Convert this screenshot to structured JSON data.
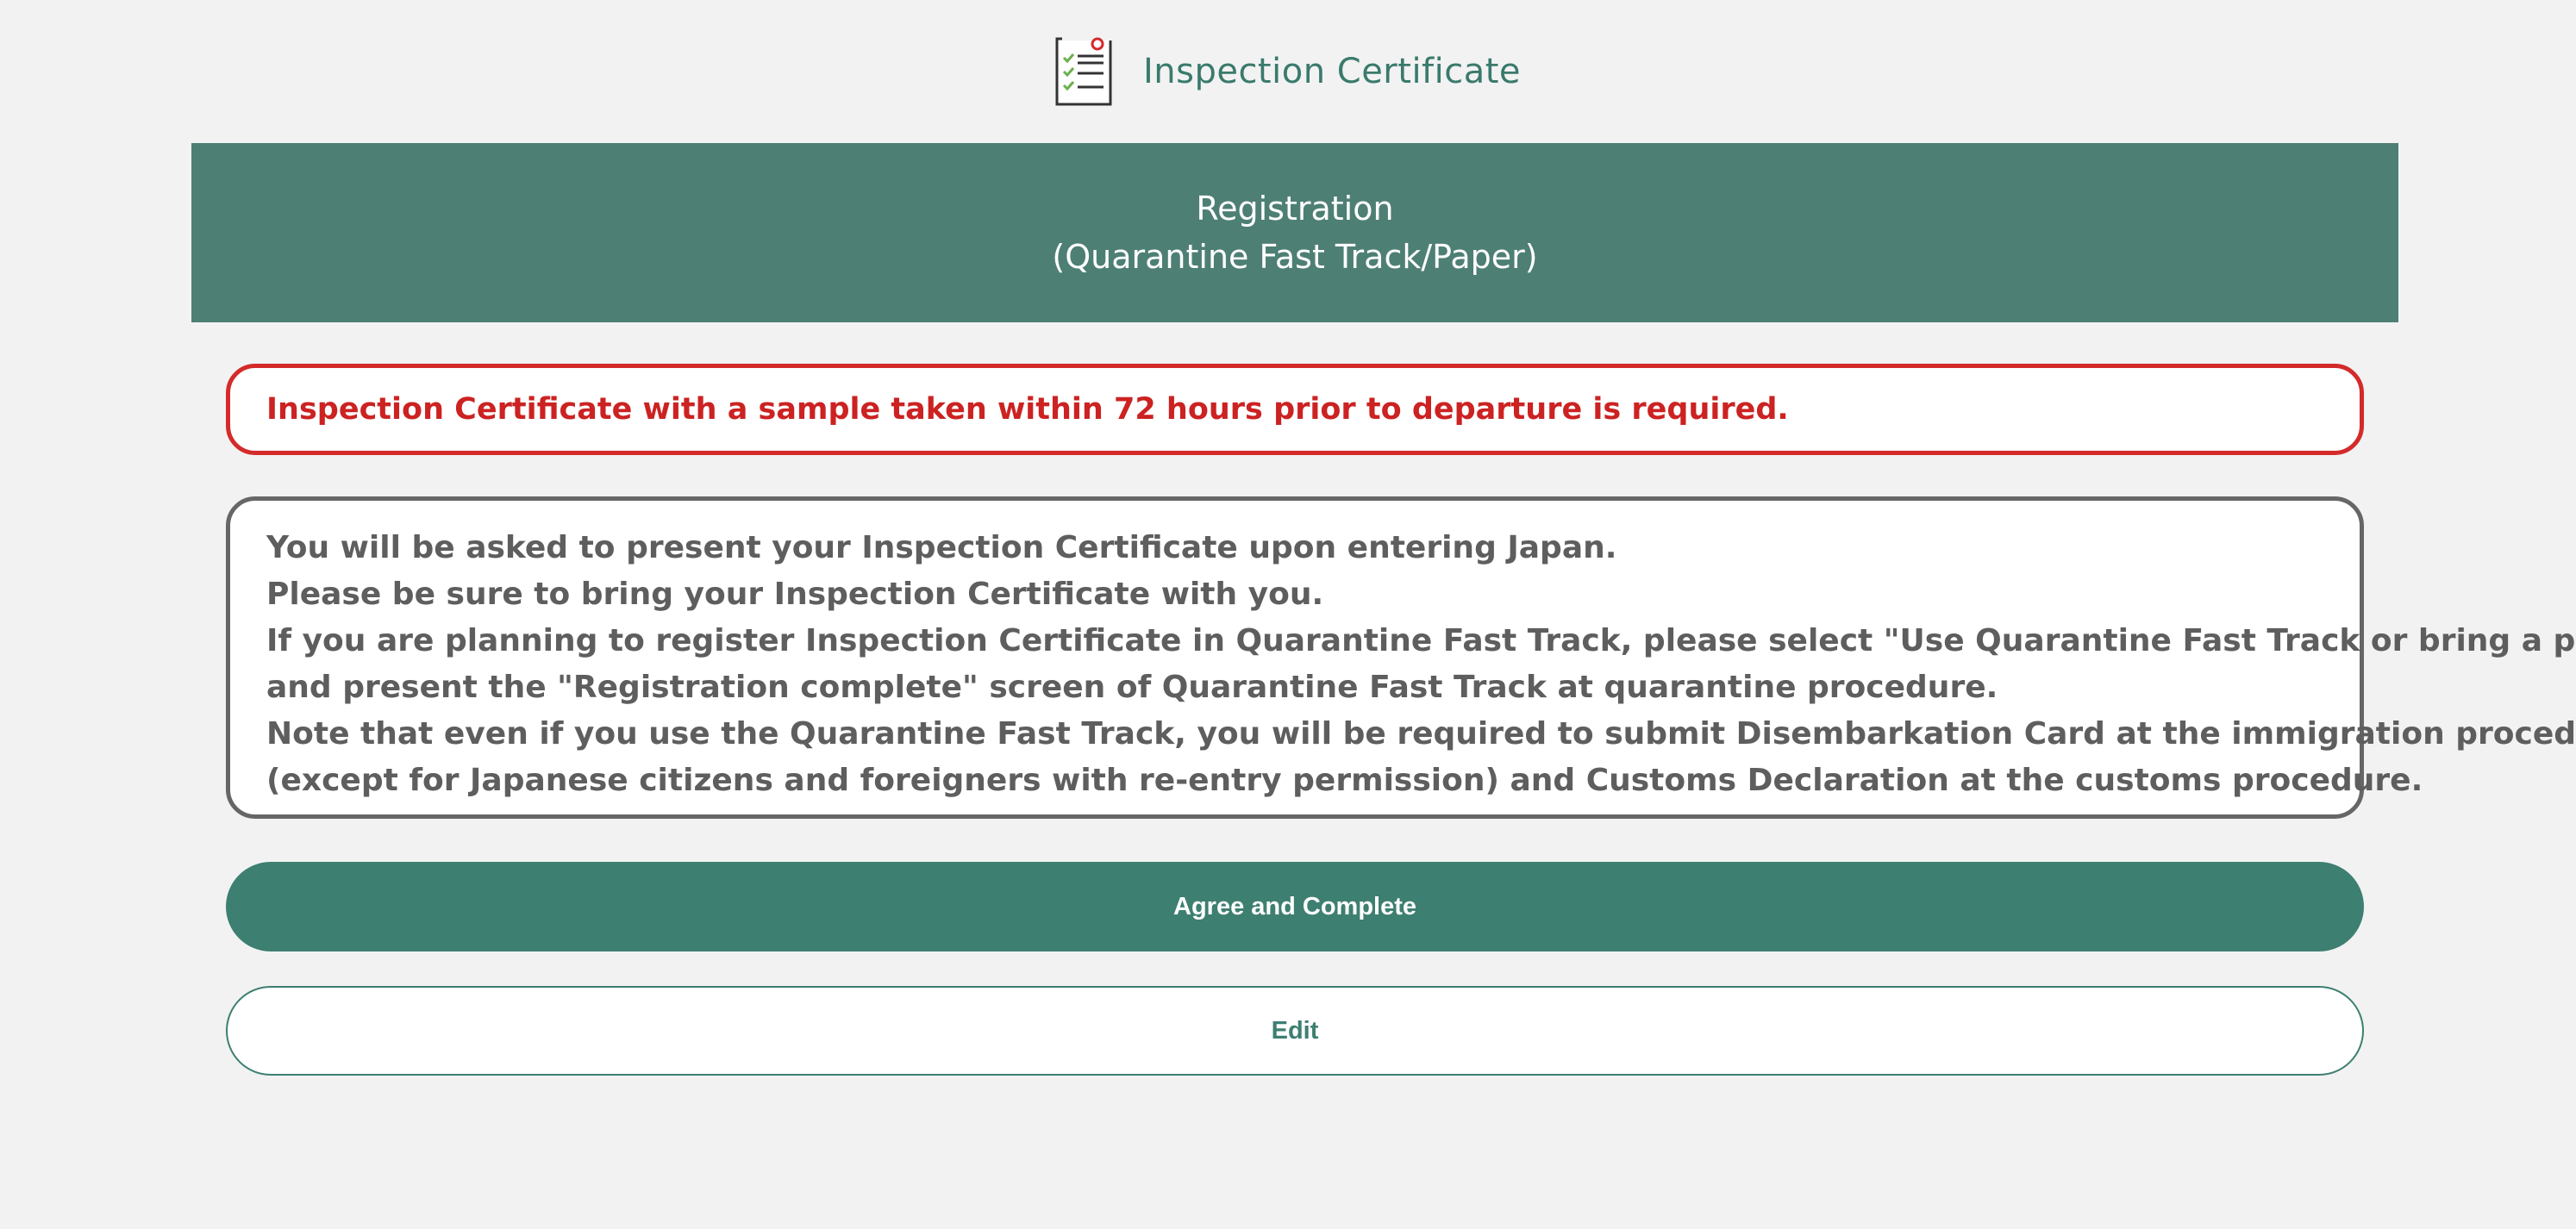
{
  "header": {
    "icon": "checklist-document-icon",
    "title": "Inspection Certificate"
  },
  "banner": {
    "line1": "Registration",
    "line2": "(Quarantine Fast Track/Paper)"
  },
  "warning": {
    "text": "Inspection Certificate with a sample taken within 72 hours prior to departure is required."
  },
  "info": {
    "lines": [
      "You will be asked to present your Inspection Certificate upon entering Japan.",
      "Please be sure to bring your Inspection Certificate with you.",
      "If you are planning to register Inspection Certificate in Quarantine Fast Track, please select \"Use Quarantine Fast Track or bring a paper\"",
      "and present the \"Registration complete\" screen of Quarantine Fast Track at quarantine procedure.",
      "Note that even if you use the Quarantine Fast Track, you will be required to submit Disembarkation Card at the immigration procedure",
      "(except for Japanese citizens and foreigners with re-entry permission) and Customs Declaration at the customs procedure."
    ]
  },
  "actions": {
    "agree_label": "Agree and Complete",
    "edit_label": "Edit"
  },
  "colors": {
    "brand_green": "#3d7f71",
    "banner_green": "#4e7f74",
    "warning_red": "#d42a2a",
    "background": "#f2f2f2"
  }
}
